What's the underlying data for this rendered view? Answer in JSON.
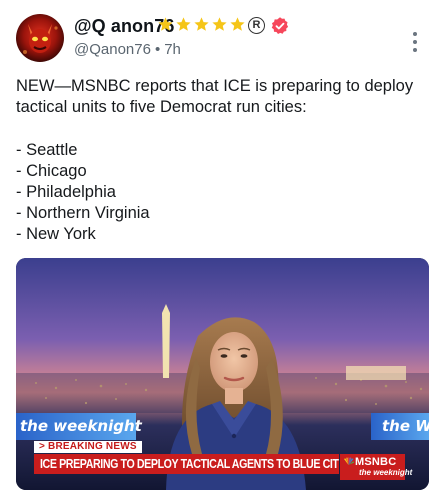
{
  "post": {
    "display_name": "@Q anon76",
    "stars_count": 5,
    "registered_symbol": "R",
    "handle": "@Qanon76",
    "separator": "•",
    "time": "7h",
    "body_intro": "NEW—MSNBC reports that ICE is preparing to deploy tactical units to five Democrat run cities:",
    "cities": [
      "- Seattle",
      "- Chicago",
      "- Philadelphia",
      "- Northern Virginia",
      "- New York"
    ]
  },
  "media": {
    "show_logo_left": "the weeknight",
    "show_logo_right": "the WE",
    "breaking_label": "> BREAKING NEWS",
    "headline": "ICE PREPARING TO DEPLOY TACTICAL AGENTS TO BLUE CITIES",
    "network": "MSNBC",
    "network_sub": "the weeknight"
  },
  "colors": {
    "verified_badge": "#f6475b",
    "star": "#f5c518",
    "breaking_red": "#c91d1d"
  }
}
